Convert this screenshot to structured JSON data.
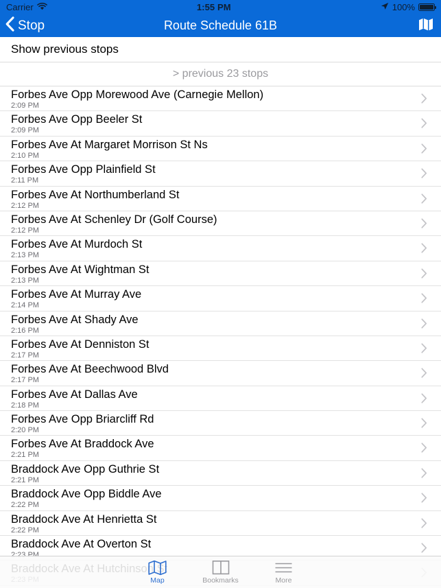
{
  "status_bar": {
    "carrier": "Carrier",
    "wifi_icon": "wifi-icon",
    "time": "1:55 PM",
    "location_icon": "location-arrow-icon",
    "battery_percent": "100%",
    "battery_icon": "battery-full-icon"
  },
  "nav_bar": {
    "back_icon": "chevron-left-icon",
    "back_label": "Stop",
    "title": "Route Schedule 61B",
    "map_icon": "map-icon",
    "background_color": "#0a6ad8",
    "tint_color": "#ffffff"
  },
  "content": {
    "show_previous_stops_label": "Show previous stops",
    "previous_stops_label": "> previous 23 stops",
    "disclosure_icon": "chevron-right-icon",
    "stops": [
      {
        "name": "Forbes Ave Opp Morewood Ave (Carnegie Mellon)",
        "time": "2:09 PM"
      },
      {
        "name": "Forbes Ave Opp Beeler St",
        "time": "2:09 PM"
      },
      {
        "name": "Forbes Ave At Margaret Morrison St Ns",
        "time": "2:10 PM"
      },
      {
        "name": "Forbes Ave Opp Plainfield St",
        "time": "2:11 PM"
      },
      {
        "name": "Forbes Ave At Northumberland St",
        "time": "2:12 PM"
      },
      {
        "name": "Forbes Ave At Schenley Dr (Golf Course)",
        "time": "2:12 PM"
      },
      {
        "name": "Forbes Ave At Murdoch St",
        "time": "2:13 PM"
      },
      {
        "name": "Forbes Ave At Wightman St",
        "time": "2:13 PM"
      },
      {
        "name": "Forbes Ave At Murray Ave",
        "time": "2:14 PM"
      },
      {
        "name": "Forbes Ave At Shady Ave",
        "time": "2:16 PM"
      },
      {
        "name": "Forbes Ave At Denniston St",
        "time": "2:17 PM"
      },
      {
        "name": "Forbes Ave At Beechwood Blvd",
        "time": "2:17 PM"
      },
      {
        "name": "Forbes Ave At Dallas Ave",
        "time": "2:18 PM"
      },
      {
        "name": "Forbes Ave Opp Briarcliff Rd",
        "time": "2:20 PM"
      },
      {
        "name": "Forbes Ave At Braddock Ave",
        "time": "2:21 PM"
      },
      {
        "name": "Braddock Ave Opp Guthrie St",
        "time": "2:21 PM"
      },
      {
        "name": "Braddock Ave Opp Biddle Ave",
        "time": "2:22 PM"
      },
      {
        "name": "Braddock Ave At Henrietta St",
        "time": "2:22 PM"
      },
      {
        "name": "Braddock Ave At Overton St",
        "time": "2:23 PM"
      },
      {
        "name": "Braddock Ave At Hutchinson St",
        "time": "2:23 PM"
      }
    ]
  },
  "tab_bar": {
    "active_color": "#2e6fd0",
    "inactive_color": "#9a9a9e",
    "tabs": [
      {
        "label": "Map",
        "icon": "map-icon",
        "active": true
      },
      {
        "label": "Bookmarks",
        "icon": "book-icon",
        "active": false
      },
      {
        "label": "More",
        "icon": "hamburger-icon",
        "active": false
      }
    ]
  }
}
